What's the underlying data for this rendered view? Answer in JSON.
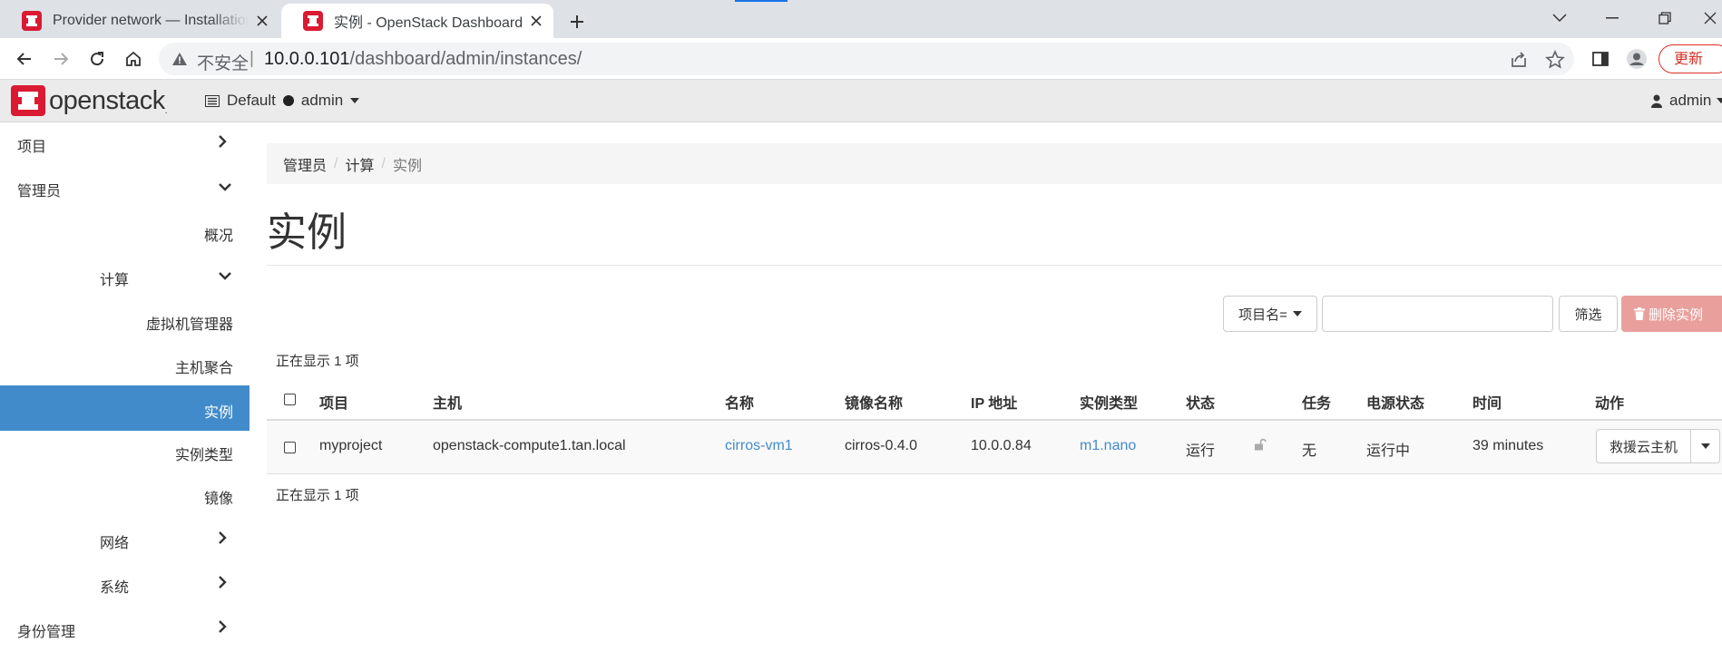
{
  "browser": {
    "tabs": [
      {
        "title": "Provider network — Installation",
        "active": false
      },
      {
        "title": "实例 - OpenStack Dashboard",
        "active": true
      }
    ],
    "address": {
      "insecure_label": "不安全",
      "separator": "|",
      "host": "10.0.0.101",
      "path": "/dashboard/admin/instances/"
    },
    "update_label": "更新",
    "colors": {
      "accent": "#1a73e8",
      "update": "#d93025"
    }
  },
  "header": {
    "logo_text": "openstack",
    "logo_mark": ".",
    "domain": "Default",
    "project": "admin",
    "user": "admin",
    "brand_color": "#da1a32"
  },
  "sidebar": {
    "project": "项目",
    "admin": "管理员",
    "overview": "概况",
    "compute": "计算",
    "hypervisors": "虚拟机管理器",
    "aggregates": "主机聚合",
    "instances": "实例",
    "flavors": "实例类型",
    "images": "镜像",
    "network": "网络",
    "system": "系统",
    "identity": "身份管理",
    "active_color": "#428bca"
  },
  "breadcrumb": {
    "items": [
      "管理员",
      "计算",
      "实例"
    ],
    "separator": "/"
  },
  "page": {
    "title": "实例"
  },
  "filters": {
    "field": "项目名=",
    "input_value": "",
    "filter_button": "筛选",
    "delete_button": "删除实例"
  },
  "table": {
    "count_top": "正在显示 1 项",
    "count_bottom": "正在显示 1 项",
    "headers": {
      "project": "项目",
      "host": "主机",
      "name": "名称",
      "image": "镜像名称",
      "ip": "IP 地址",
      "flavor": "实例类型",
      "status": "状态",
      "task": "任务",
      "power": "电源状态",
      "time": "时间",
      "actions": "动作"
    },
    "rows": [
      {
        "project": "myproject",
        "host": "openstack-compute1.tan.local",
        "name": "cirros-vm1",
        "image": "cirros-0.4.0",
        "ip": "10.0.0.84",
        "flavor": "m1.nano",
        "status": "运行",
        "task": "无",
        "power": "运行中",
        "time": "39 minutes",
        "action": "救援云主机"
      }
    ]
  }
}
